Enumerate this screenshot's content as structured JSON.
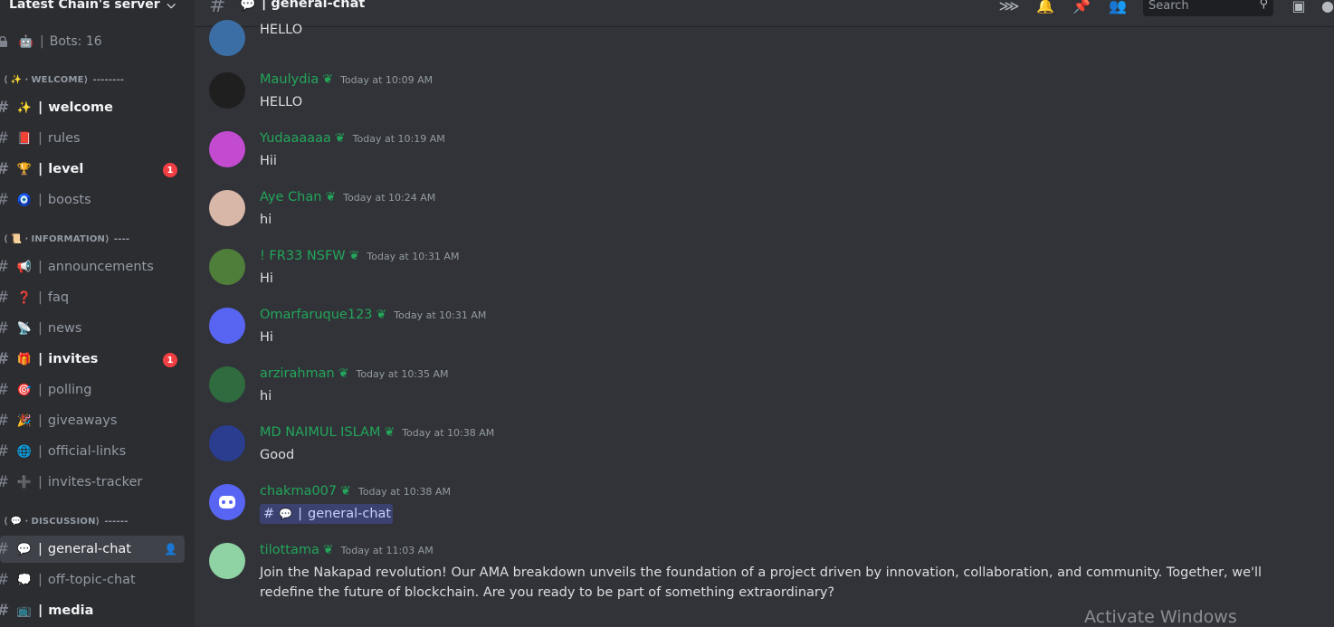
{
  "server": {
    "name": "Latest Chain's server",
    "bots_label": "Bots: 16"
  },
  "categories": [
    {
      "label": "WELCOME",
      "dashes": "--------",
      "icon": "✨"
    },
    {
      "label": "INFORMATION",
      "dashes": "----",
      "icon": "📜"
    },
    {
      "label": "DISCUSSION",
      "dashes": "------",
      "icon": "💬"
    }
  ],
  "channels": [
    {
      "name": "welcome",
      "icon": "✨",
      "unread": true
    },
    {
      "name": "rules",
      "icon": "📕"
    },
    {
      "name": "level",
      "icon": "🏆",
      "unread": true,
      "badge": "1"
    },
    {
      "name": "boosts",
      "icon": "🧿"
    },
    {
      "name": "announcements",
      "icon": "📢"
    },
    {
      "name": "faq",
      "icon": "❓"
    },
    {
      "name": "news",
      "icon": "📡"
    },
    {
      "name": "invites",
      "icon": "🎁",
      "unread": true,
      "badge": "1"
    },
    {
      "name": "polling",
      "icon": "🎯"
    },
    {
      "name": "giveaways",
      "icon": "🎉"
    },
    {
      "name": "official-links",
      "icon": "🌐"
    },
    {
      "name": "invites-tracker",
      "icon": "➕"
    },
    {
      "name": "general-chat",
      "icon": "💬",
      "active": true
    },
    {
      "name": "off-topic-chat",
      "icon": "💭"
    },
    {
      "name": "media",
      "icon": "📺",
      "unread": true
    }
  ],
  "topbar": {
    "channel_name": "general-chat",
    "channel_icon": "💬",
    "search_placeholder": "Search"
  },
  "messages": [
    {
      "text": "HELLO"
    },
    {
      "user": "Maulydia",
      "time": "Today at 10:09 AM",
      "text": "HELLO"
    },
    {
      "user": "Yudaaaaaa",
      "time": "Today at 10:19 AM",
      "text": "Hii"
    },
    {
      "user": "Aye Chan",
      "time": "Today at 10:24 AM",
      "text": "hi"
    },
    {
      "user": "! FR33 NSFW",
      "time": "Today at 10:31 AM",
      "text": "Hi"
    },
    {
      "user": "Omarfaruque123",
      "time": "Today at 10:31 AM",
      "text": "Hi"
    },
    {
      "user": "arzirahman",
      "time": "Today at 10:35 AM",
      "text": "hi"
    },
    {
      "user": "MD NAIMUL ISLAM",
      "time": "Today at 10:38 AM",
      "text": "Good"
    },
    {
      "user": "chakma007",
      "time": "Today at 10:38 AM",
      "mention": "general-chat"
    },
    {
      "user": "tilottama",
      "time": "Today at 11:03 AM",
      "text": "Join the Nakapad revolution! Our AMA breakdown unveils the foundation of a project driven by innovation, collaboration, and community. Together, we'll redefine the future of blockchain. Are you ready to be part of something extraordinary?"
    }
  ],
  "watermark": "Activate Windows",
  "colors": {
    "sidebar": "#2b2d31",
    "chat": "#313338",
    "username": "#23a55a",
    "badge": "#f23f43",
    "mention_bg": "#3c4270"
  }
}
